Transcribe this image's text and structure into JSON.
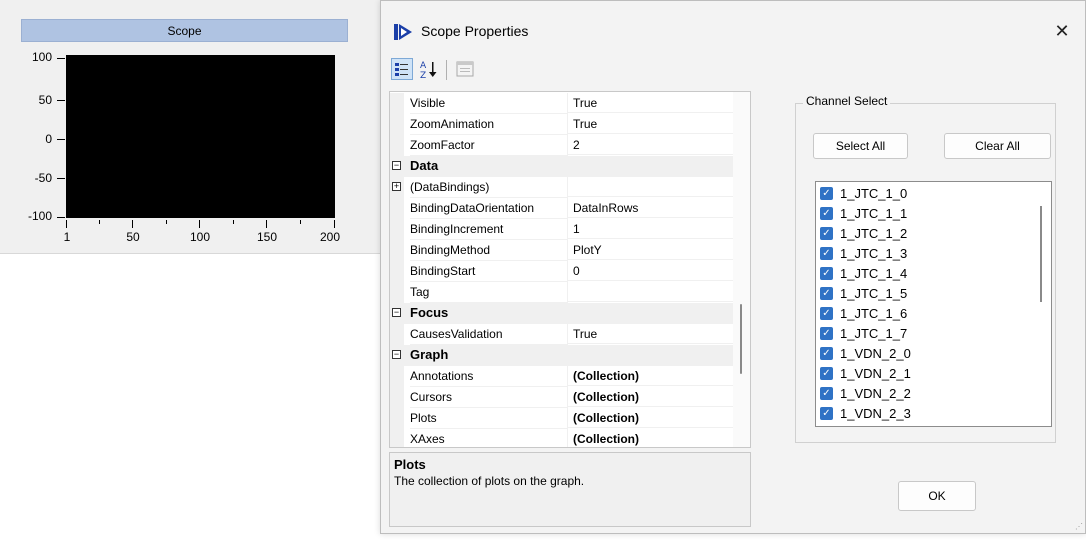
{
  "scope": {
    "title": "Scope",
    "y_ticks": [
      "100",
      "50",
      "0",
      "-50",
      "-100"
    ],
    "x_ticks": [
      "1",
      "50",
      "100",
      "150",
      "200"
    ]
  },
  "dialog": {
    "title": "Scope Properties",
    "close_label": "✕",
    "toolbar": {
      "categorized_icon": "categorized-icon",
      "alphabetical_icon": "sort-az-icon",
      "property_pages_icon": "property-pages-icon"
    },
    "properties": [
      {
        "type": "prop",
        "name": "Visible",
        "value": "True"
      },
      {
        "type": "prop",
        "name": "ZoomAnimation",
        "value": "True"
      },
      {
        "type": "prop",
        "name": "ZoomFactor",
        "value": "2"
      },
      {
        "type": "cat",
        "name": "Data",
        "expander": "⊟"
      },
      {
        "type": "prop",
        "name": "(DataBindings)",
        "value": "",
        "expander": "⊞"
      },
      {
        "type": "prop",
        "name": "BindingDataOrientation",
        "value": "DataInRows"
      },
      {
        "type": "prop",
        "name": "BindingIncrement",
        "value": "1"
      },
      {
        "type": "prop",
        "name": "BindingMethod",
        "value": "PlotY"
      },
      {
        "type": "prop",
        "name": "BindingStart",
        "value": "0"
      },
      {
        "type": "prop",
        "name": "Tag",
        "value": ""
      },
      {
        "type": "cat",
        "name": "Focus",
        "expander": "⊟"
      },
      {
        "type": "prop",
        "name": "CausesValidation",
        "value": "True"
      },
      {
        "type": "cat",
        "name": "Graph",
        "expander": "⊟"
      },
      {
        "type": "prop",
        "name": "Annotations",
        "value": "(Collection)",
        "bold": true
      },
      {
        "type": "prop",
        "name": "Cursors",
        "value": "(Collection)",
        "bold": true
      },
      {
        "type": "prop",
        "name": "Plots",
        "value": "(Collection)",
        "bold": true
      },
      {
        "type": "prop",
        "name": "XAxes",
        "value": "(Collection)",
        "bold": true
      }
    ],
    "description": {
      "title": "Plots",
      "text": "The collection of plots on the graph."
    },
    "channel_select": {
      "legend": "Channel Select",
      "select_all_label": "Select All",
      "clear_all_label": "Clear All",
      "channels": [
        {
          "label": "1_JTC_1_0",
          "checked": true
        },
        {
          "label": "1_JTC_1_1",
          "checked": true
        },
        {
          "label": "1_JTC_1_2",
          "checked": true
        },
        {
          "label": "1_JTC_1_3",
          "checked": true
        },
        {
          "label": "1_JTC_1_4",
          "checked": true
        },
        {
          "label": "1_JTC_1_5",
          "checked": true
        },
        {
          "label": "1_JTC_1_6",
          "checked": true
        },
        {
          "label": "1_JTC_1_7",
          "checked": true
        },
        {
          "label": "1_VDN_2_0",
          "checked": true
        },
        {
          "label": "1_VDN_2_1",
          "checked": true
        },
        {
          "label": "1_VDN_2_2",
          "checked": true
        },
        {
          "label": "1_VDN_2_3",
          "checked": true
        }
      ]
    },
    "ok_label": "OK"
  },
  "colors": {
    "scope_title_bg": "#afc3e2",
    "plot_bg": "#000000",
    "checkbox": "#2f72c5",
    "icon_blue": "#1b3fa8"
  }
}
